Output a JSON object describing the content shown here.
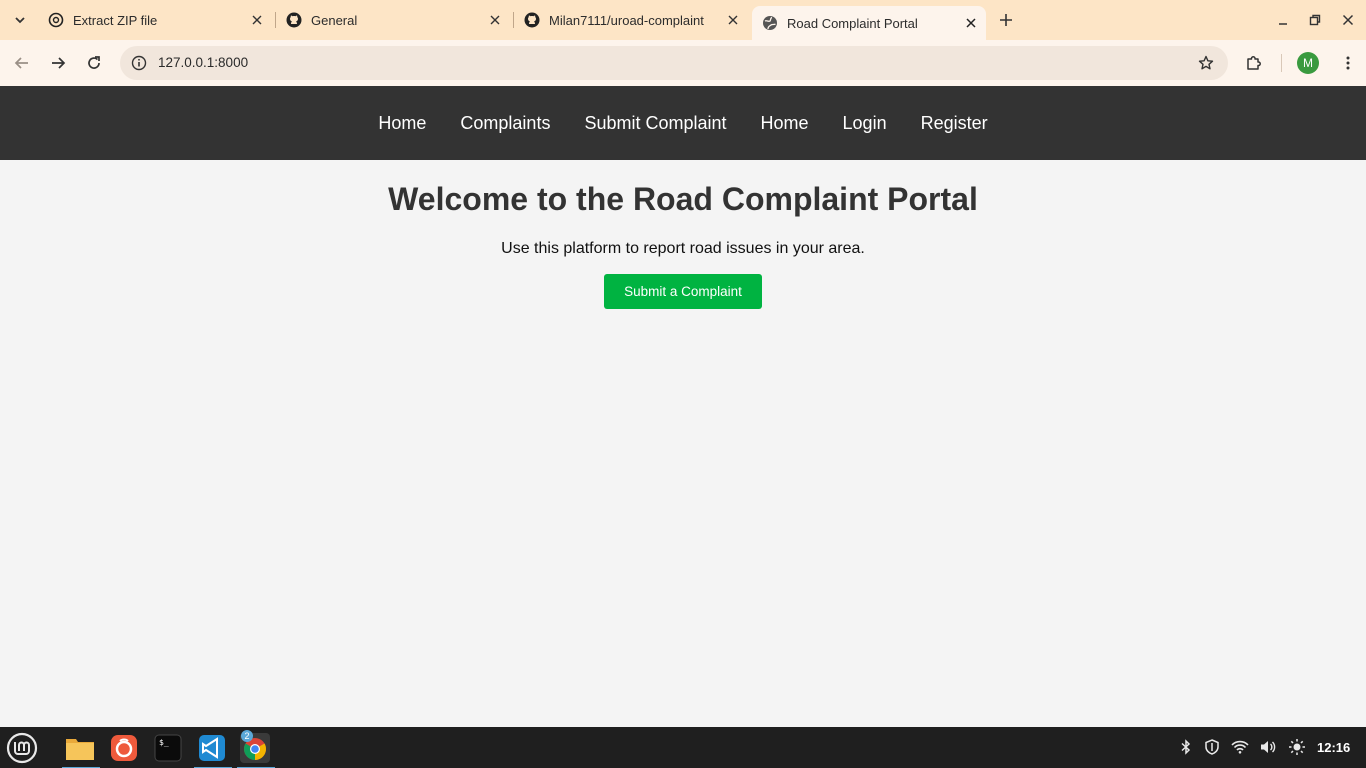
{
  "browser": {
    "tabs": [
      {
        "title": "Extract ZIP file",
        "icon": "openai-icon"
      },
      {
        "title": "General",
        "icon": "github-icon"
      },
      {
        "title": "Milan7111/uroad-complaint",
        "icon": "github-icon"
      },
      {
        "title": "Road Complaint Portal",
        "icon": "globe-icon",
        "active": true
      }
    ],
    "url": "127.0.0.1:8000",
    "profile_initial": "M"
  },
  "page": {
    "nav": [
      "Home",
      "Complaints",
      "Submit Complaint",
      "Home",
      "Login",
      "Register"
    ],
    "heading": "Welcome to the Road Complaint Portal",
    "subtitle": "Use this platform to report road issues in your area.",
    "button_label": "Submit a Complaint"
  },
  "taskbar": {
    "clock": "12:16",
    "chrome_badge": "2"
  },
  "colors": {
    "tabstrip": "#fde5c6",
    "nav_bg": "#333333",
    "cta_green": "#00b341",
    "page_bg": "#f4f4f4"
  }
}
